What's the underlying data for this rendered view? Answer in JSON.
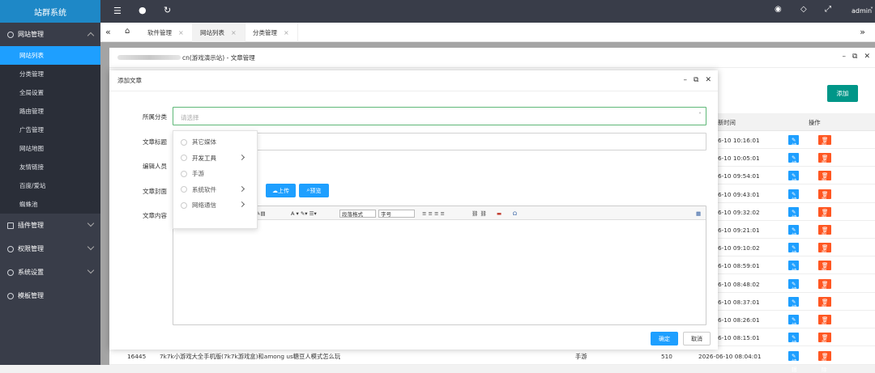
{
  "app_title": "站群系统",
  "sidebar": {
    "group_site": "网站管理",
    "sub_items": [
      "网站列表",
      "分类管理",
      "全局设置",
      "路由管理",
      "广告管理",
      "网站地图",
      "友情链接",
      "百度/爱站",
      "蜘蛛池"
    ],
    "groups": [
      "插件管理",
      "权限管理",
      "系统设置",
      "模板管理"
    ]
  },
  "topbar": {
    "user": "admin"
  },
  "tabs": [
    "软件管理",
    "网站列表",
    "分类管理"
  ],
  "tab_close": "×",
  "page_window": {
    "title_suffix": "cn(游戏演示站) - 文章管理",
    "add_button": "添加",
    "col_update_time": "新时间",
    "col_actions": "操作",
    "times": [
      "6-10 10:16:01",
      "6-10 10:05:01",
      "6-10 09:54:01",
      "6-10 09:43:01",
      "6-10 09:32:02",
      "6-10 09:21:01",
      "6-10 09:10:02",
      "6-10 08:59:01",
      "6-10 08:48:02",
      "6-10 08:37:01",
      "6-10 08:26:01",
      "6-10 08:15:01"
    ],
    "edit_label": "编辑",
    "delete_label": "删除",
    "last_row": {
      "id": "16445",
      "title": "7k7k小游戏大全手机版(7k7k游戏盒)和among us糖豆人模式怎么玩",
      "category": "手游",
      "views": "510",
      "time": "2026-06-10 08:04:01"
    }
  },
  "dialog": {
    "title": "添加文章",
    "labels": {
      "category": "所属分类",
      "title": "文章标题",
      "editor": "编辑人员",
      "cover": "文章封面",
      "content": "文章内容"
    },
    "category_placeholder": "请选择",
    "upload_button": "上传",
    "preview_button": "预览",
    "toolbar": {
      "paragraph": "段落格式",
      "font_size": "字号"
    },
    "dropdown_options": [
      "其它媒体",
      "开发工具",
      "手游",
      "系统软件",
      "网络通信"
    ],
    "confirm": "确定",
    "cancel": "取消"
  },
  "colors": {
    "sidebar_bg": "#393d49",
    "accent": "#1e9fff",
    "logo_bg": "#1e88c7",
    "danger": "#ff5722",
    "add_btn": "#009688"
  }
}
